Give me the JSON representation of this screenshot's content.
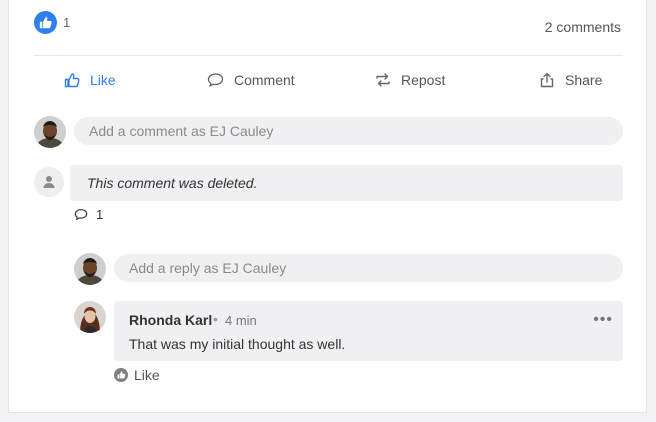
{
  "post": {
    "likes_count": "1",
    "comments_count": "2 comments"
  },
  "actions": {
    "like": "Like",
    "comment": "Comment",
    "repost": "Repost",
    "share": "Share"
  },
  "comment_input": {
    "placeholder": "Add a comment as EJ Cauley"
  },
  "deleted_comment": {
    "text": "This comment was deleted.",
    "reply_count": "1"
  },
  "reply_input": {
    "placeholder": "Add a reply as EJ Cauley"
  },
  "reply": {
    "author": "Rhonda Karl",
    "separator": "•",
    "time": "4 min",
    "text": "That was my initial thought as well.",
    "more": "•••",
    "like_label": "Like"
  },
  "colors": {
    "accent": "#2f80ed",
    "pill_bg": "#f0f0f2"
  }
}
